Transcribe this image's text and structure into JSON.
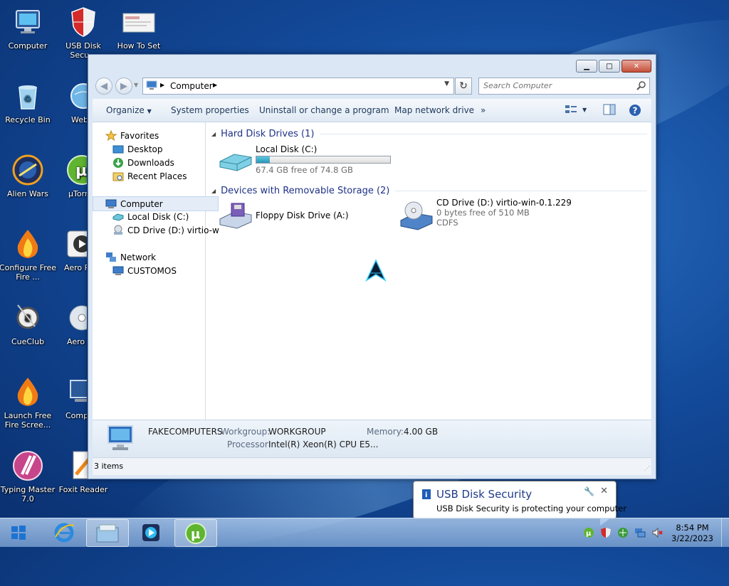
{
  "desktop": {
    "icons": [
      {
        "label": "Computer",
        "icon": "computer-monitor"
      },
      {
        "label": "USB Disk Secu...",
        "icon": "shield"
      },
      {
        "label": "How To Set",
        "icon": "document-screenshot"
      },
      {
        "label": "Recycle Bin",
        "icon": "recycle-bin"
      },
      {
        "label": "Web Navigator",
        "icon": "globe"
      },
      {
        "label": "Alien Wars",
        "icon": "alien-wars"
      },
      {
        "label": "µTorrent",
        "icon": "utorrent"
      },
      {
        "label": "Configure Free Fire ...",
        "icon": "flame"
      },
      {
        "label": "Aero Player",
        "icon": "media-player"
      },
      {
        "label": "CueClub",
        "icon": "cue-ball"
      },
      {
        "label": "Aero Burn",
        "icon": "disc-burn"
      },
      {
        "label": "Launch Free Fire Scree...",
        "icon": "flame"
      },
      {
        "label": "Comp Worms",
        "icon": "computer-worms"
      },
      {
        "label": "Typing Master 7.0",
        "icon": "typing-master"
      },
      {
        "label": "Foxit Reader",
        "icon": "foxit-reader"
      }
    ]
  },
  "explorer": {
    "address": {
      "location": "Computer"
    },
    "search": {
      "placeholder": "Search Computer"
    },
    "commands": {
      "organize": "Organize",
      "system_properties": "System properties",
      "uninstall": "Uninstall or change a program",
      "map_drive": "Map network drive",
      "more": "»"
    },
    "nav": {
      "favorites": "Favorites",
      "desktop": "Desktop",
      "downloads": "Downloads",
      "recent": "Recent Places",
      "computer": "Computer",
      "local_disk": "Local Disk (C:)",
      "cd_drive": "CD Drive (D:) virtio-w",
      "network": "Network",
      "customos": "CUSTOMOS"
    },
    "groups": {
      "hdd": "Hard Disk Drives (1)",
      "removable": "Devices with Removable Storage (2)"
    },
    "drives": {
      "local": {
        "name": "Local Disk (C:)",
        "free": "67.4 GB free of 74.8 GB",
        "used_fraction": 0.099
      },
      "floppy": {
        "name": "Floppy Disk Drive (A:)"
      },
      "cd": {
        "name": "CD Drive (D:) virtio-win-0.1.229",
        "free": "0 bytes free of 510 MB",
        "fs": "CDFS"
      }
    },
    "details": {
      "computer_name": "FAKECOMPUTERS",
      "workgroup_label": "Workgroup:",
      "workgroup": "WORKGROUP",
      "memory_label": "Memory:",
      "memory": "4.00 GB",
      "processor_label": "Processor:",
      "processor": "Intel(R) Xeon(R) CPU E5..."
    },
    "status": {
      "items": "3 items"
    }
  },
  "notification": {
    "title": "USB Disk Security",
    "message": "USB Disk Security is protecting your computer"
  },
  "taskbar": {
    "time": "8:54 PM",
    "date": "3/22/2023"
  },
  "colors": {
    "accent": "#1e3287",
    "disk_bar": "#2a97b8"
  }
}
